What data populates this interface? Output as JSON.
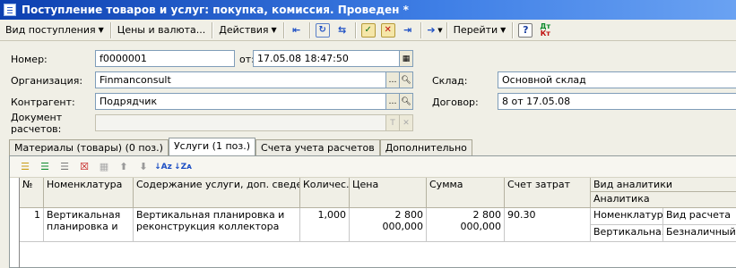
{
  "window": {
    "title": "Поступление товаров и услуг: покупка, комиссия. Проведен *"
  },
  "toolbar": {
    "receipt_type": "Вид поступления",
    "prices_currency": "Цены и валюта...",
    "actions": "Действия",
    "go_to": "Перейти",
    "help": "?",
    "dt_kt_top": "Дт",
    "dt_kt_bottom": "Кт"
  },
  "form": {
    "number_label": "Номер:",
    "number_value": "f0000001",
    "date_label": "от:",
    "date_value": "17.05.08 18:47:50",
    "organization_label": "Организация:",
    "organization_value": "Finmanconsult",
    "warehouse_label": "Склад:",
    "warehouse_value": "Основной склад",
    "counterparty_label": "Контрагент:",
    "counterparty_value": "Подрядчик",
    "contract_label": "Договор:",
    "contract_value": "8  от 17.05.08",
    "settlement_doc_label_1": "Документ",
    "settlement_doc_label_2": "расчетов:",
    "settlement_doc_value": ""
  },
  "tabs": [
    {
      "label": "Материалы (товары) (0 поз.)"
    },
    {
      "label": "Услуги (1 поз.)"
    },
    {
      "label": "Счета учета расчетов"
    },
    {
      "label": "Дополнительно"
    }
  ],
  "table": {
    "headers": {
      "no": "№",
      "nomenclature": "Номенклатура",
      "content": "Содержание услуги, доп. сведения",
      "quantity": "Количес...",
      "price": "Цена",
      "sum": "Сумма",
      "cost_account": "Счет затрат",
      "analytics_type": "Вид аналитики",
      "analytics": "Аналитика"
    },
    "rows": [
      {
        "no": "1",
        "nomenclature": "Вертикальная планировка и",
        "content": "Вертикальная планировка и реконструкция коллектора",
        "quantity": "1,000",
        "price": "2 800 000,000",
        "sum": "2 800 000,000",
        "cost_account": "90.30",
        "analytics_type_1": "Номенклатура",
        "analytics_value_1": "Вид расчета",
        "analytics_type_2": "Вертикальна...",
        "analytics_value_2": "Безналичный"
      }
    ]
  }
}
